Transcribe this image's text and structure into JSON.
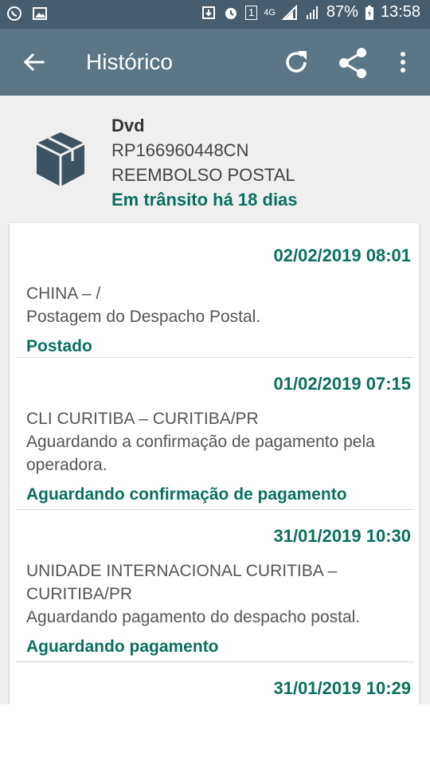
{
  "status_bar": {
    "battery": "87%",
    "time": "13:58",
    "network": "4G",
    "sim_slot": "1"
  },
  "toolbar": {
    "title": "Histórico",
    "icons": [
      "back-arrow-icon",
      "refresh-icon",
      "share-icon",
      "more-vert-icon"
    ]
  },
  "package": {
    "name": "Dvd",
    "code": "RP166960448CN",
    "service": "REEMBOLSO POSTAL",
    "transit_status": "Em trânsito há 18 dias",
    "icon": "package-box-icon"
  },
  "events": [
    {
      "datetime": "02/02/2019 08:01",
      "location": "CHINA – /",
      "description": "Postagem do Despacho Postal.",
      "status": "Postado"
    },
    {
      "datetime": "01/02/2019 07:15",
      "location": "CLI CURITIBA – CURITIBA/PR",
      "description": "Aguardando a confirmação de pagamento pela operadora.",
      "status": "Aguardando confirmação de pagamento"
    },
    {
      "datetime": "31/01/2019 10:30",
      "location": "UNIDADE INTERNACIONAL CURITIBA – CURITIBA/PR",
      "description": "Aguardando pagamento do despacho postal.",
      "status": "Aguardando pagamento"
    },
    {
      "datetime": "31/01/2019 10:29"
    }
  ],
  "colors": {
    "toolbar": "#5c7686",
    "status_bar": "#475d6e",
    "accent_green": "#0a7060",
    "background": "#efefef"
  }
}
